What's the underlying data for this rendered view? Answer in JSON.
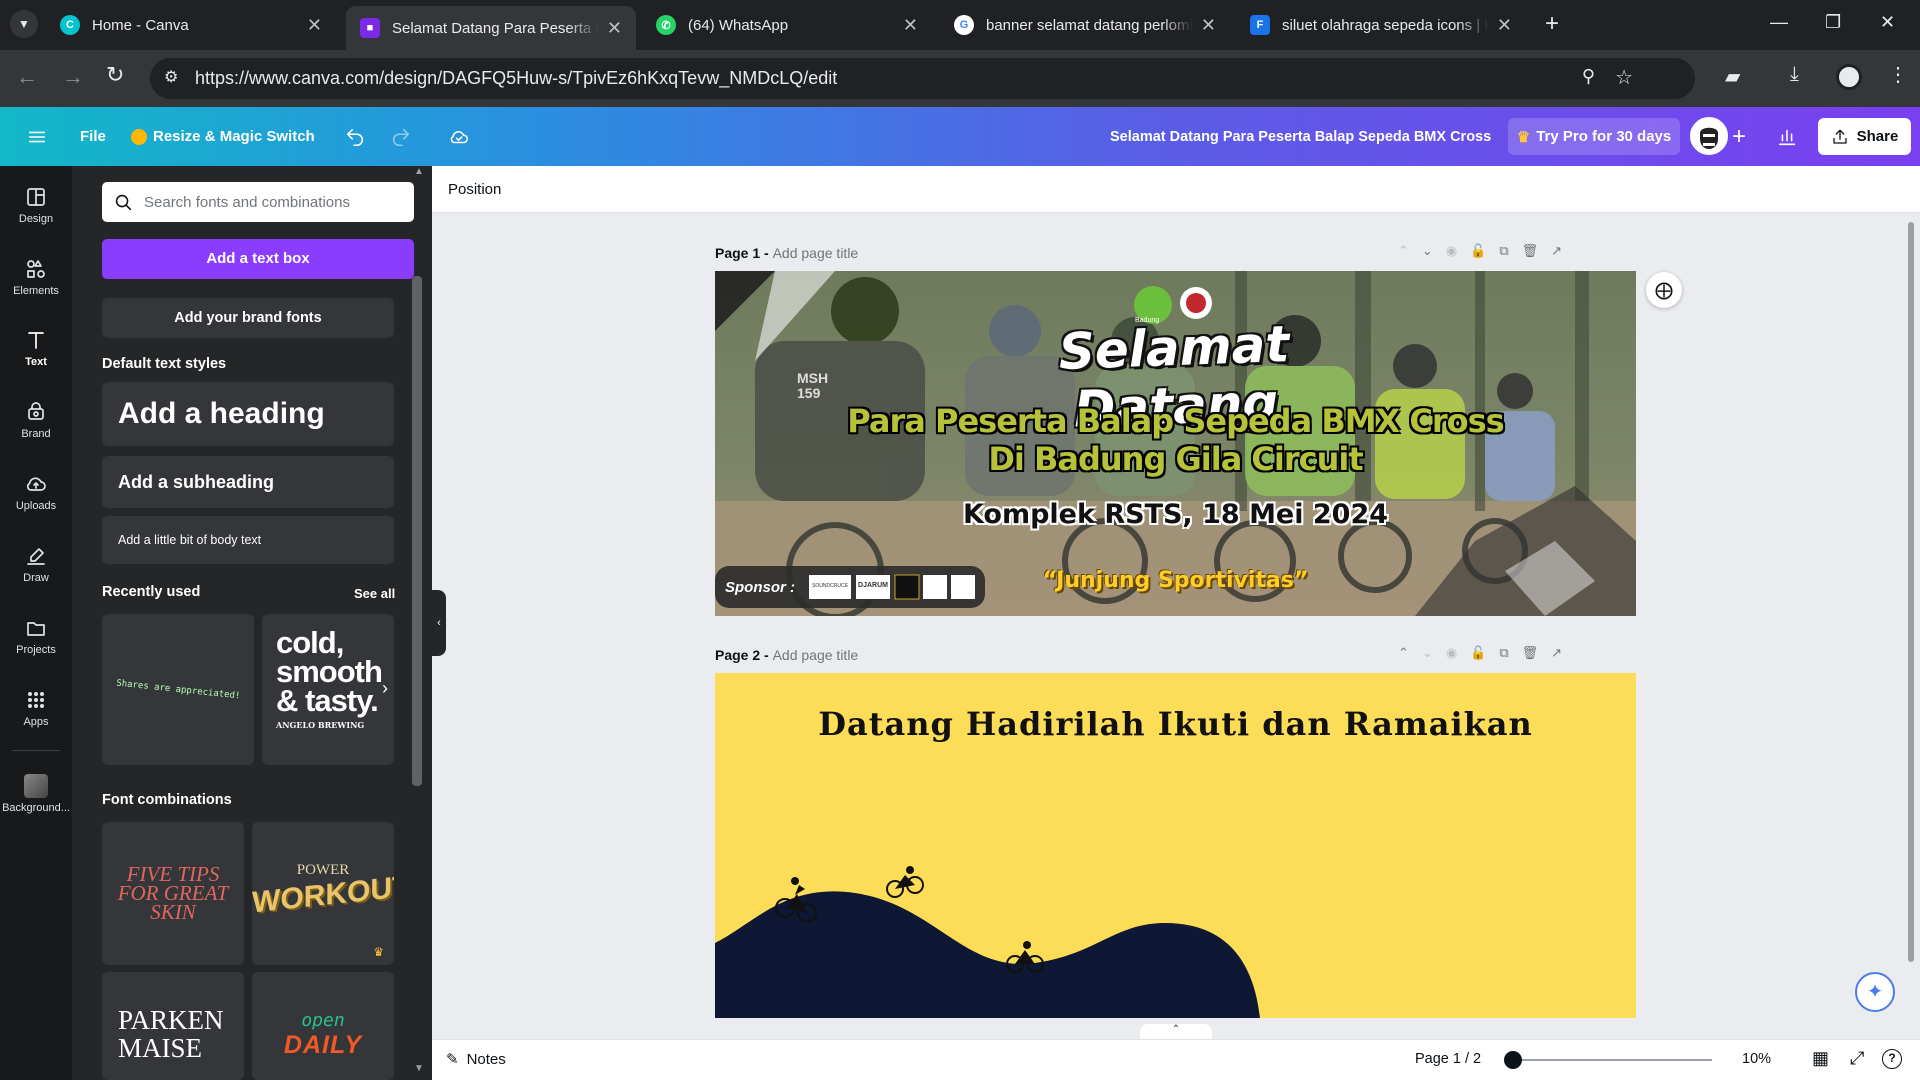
{
  "browser": {
    "tabs": [
      {
        "title": "Home - Canva",
        "favicon": "canva-icon",
        "color": "#00c4cc"
      },
      {
        "title": "Selamat Datang Para Peserta Ba",
        "favicon": "canva-doc-icon",
        "color": "#7d2ae8",
        "active": true
      },
      {
        "title": "(64) WhatsApp",
        "favicon": "whatsapp-icon",
        "color": "#25d366"
      },
      {
        "title": "banner selamat datang perlomba",
        "favicon": "google-icon",
        "color": "#4285f4"
      },
      {
        "title": "siluet olahraga sepeda icons | Fr",
        "favicon": "flaticon-icon",
        "color": "#1a73e8"
      }
    ],
    "url": "https://www.canva.com/design/DAGFQ5Huw-s/TpivEz6hKxqTevw_NMDcLQ/edit"
  },
  "header": {
    "file_label": "File",
    "resize_label": "Resize & Magic Switch",
    "doc_title": "Selamat Datang Para Peserta Balap Sepeda BMX Cross",
    "try_pro_label": "Try Pro for 30 days",
    "share_label": "Share"
  },
  "rail": [
    {
      "label": "Design",
      "icon": "design-icon"
    },
    {
      "label": "Elements",
      "icon": "elements-icon"
    },
    {
      "label": "Text",
      "icon": "text-icon",
      "active": true
    },
    {
      "label": "Brand",
      "icon": "brand-icon"
    },
    {
      "label": "Uploads",
      "icon": "uploads-icon"
    },
    {
      "label": "Draw",
      "icon": "draw-icon"
    },
    {
      "label": "Projects",
      "icon": "projects-icon"
    },
    {
      "label": "Apps",
      "icon": "apps-icon"
    },
    {
      "label": "Background...",
      "icon": "background-icon"
    }
  ],
  "panel": {
    "search_placeholder": "Search fonts and combinations",
    "add_text_box": "Add a text box",
    "add_brand_fonts": "Add your brand fonts",
    "default_styles_title": "Default text styles",
    "heading": "Add a heading",
    "subheading": "Add a subheading",
    "body_text": "Add a little bit of body text",
    "recently_used_title": "Recently used",
    "see_all": "See all",
    "recent_1": "Shares are appreciated!",
    "recent_2_line1": "cold,",
    "recent_2_line2": "smooth",
    "recent_2_line3": "& tasty.",
    "recent_2_small": "ANGELO BREWING",
    "font_combinations_title": "Font combinations",
    "combo_1": "FIVE TIPS FOR GREAT SKIN",
    "combo_2_small": "POWER",
    "combo_2_big": "WORKOUT",
    "combo_3_line1": "PARKEN",
    "combo_3_line2": "MAISE",
    "combo_4_small": "open",
    "combo_4_big": "DAILY"
  },
  "canvas": {
    "position_label": "Position",
    "page1": {
      "label": "Page 1 - ",
      "add_title": "Add page title",
      "title": "Selamat Datang",
      "line1": "Para Peserta Balap Sepeda BMX Cross",
      "line2": "Di Badung Gila Circuit",
      "date": "Komplek RSTS, 18 Mei 2024",
      "motto": "“Junjung Sportivitas”",
      "sponsor": "Sponsor :",
      "jersey": "MSH 159",
      "logo_text": "Badung",
      "sponsor_logo_1": "SOUNDCRUCE",
      "sponsor_logo_2": "DJARUM"
    },
    "page2": {
      "label": "Page 2 - ",
      "add_title": "Add page title",
      "headline": "Datang Hadirilah Ikuti dan Ramaikan"
    }
  },
  "footer": {
    "notes_label": "Notes",
    "page_indicator": "Page 1 / 2",
    "zoom": "10%"
  }
}
